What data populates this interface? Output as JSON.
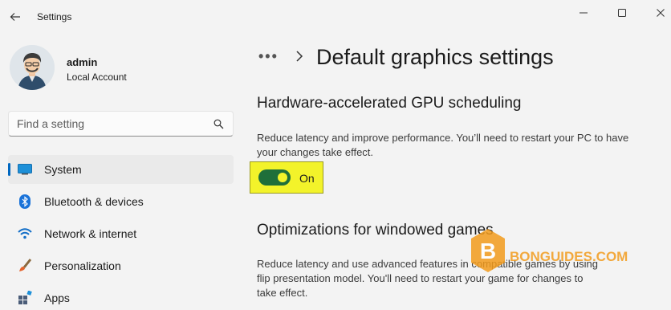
{
  "window": {
    "app_title": "Settings"
  },
  "profile": {
    "name": "admin",
    "account_type": "Local Account"
  },
  "search": {
    "placeholder": "Find a setting"
  },
  "sidebar": {
    "items": [
      {
        "label": "System",
        "icon": "monitor-icon",
        "active": true
      },
      {
        "label": "Bluetooth & devices",
        "icon": "bluetooth-icon"
      },
      {
        "label": "Network & internet",
        "icon": "wifi-icon"
      },
      {
        "label": "Personalization",
        "icon": "brush-icon"
      },
      {
        "label": "Apps",
        "icon": "apps-icon"
      }
    ]
  },
  "breadcrumb": {
    "more": "•••",
    "title": "Default graphics settings"
  },
  "sections": [
    {
      "title": "Hardware-accelerated GPU scheduling",
      "description": "Reduce latency and improve performance. You’ll need to restart your PC to have your changes take effect.",
      "toggle_state": "On"
    },
    {
      "title": "Optimizations for windowed games",
      "description": "Reduce latency and use advanced features in compatible games by using flip presentation model. You'll need to restart your game for changes to take effect."
    }
  ],
  "watermark": {
    "text": "BONGUIDES.COM",
    "letter": "B"
  },
  "colors": {
    "accent": "#0067c0",
    "toggle_on": "#1f6f3a",
    "highlight": "#f3f32a",
    "watermark": "#f29b1d"
  }
}
